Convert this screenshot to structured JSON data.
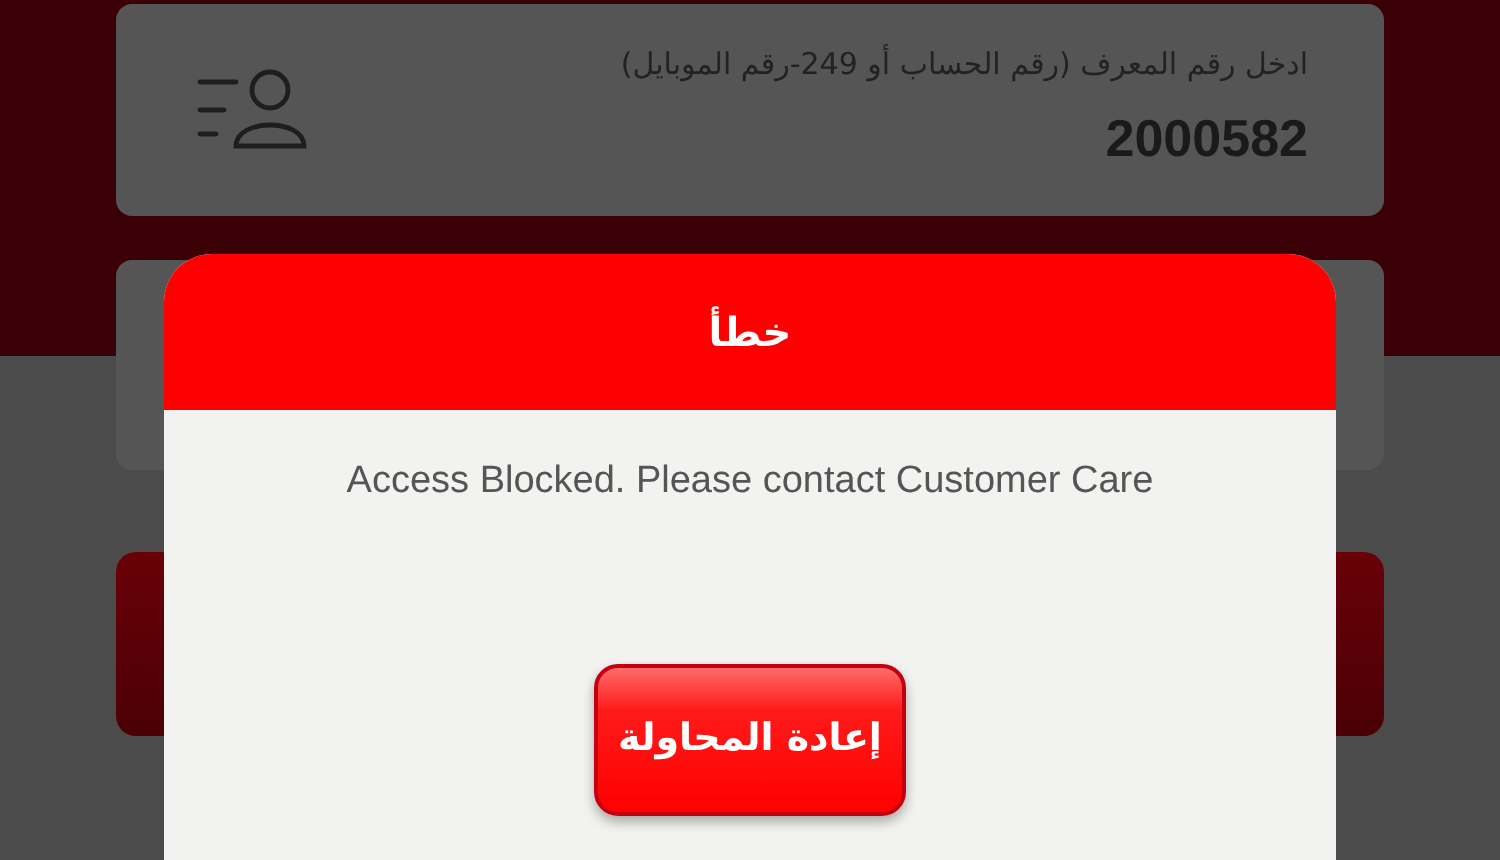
{
  "id_field": {
    "label": "ادخل رقم المعرف (رقم الحساب أو 249-رقم الموبايل)",
    "value": "2000582"
  },
  "dialog": {
    "title": "خطأ",
    "message": "Access Blocked. Please contact Customer Care",
    "button": "إعادة المحاولة"
  }
}
